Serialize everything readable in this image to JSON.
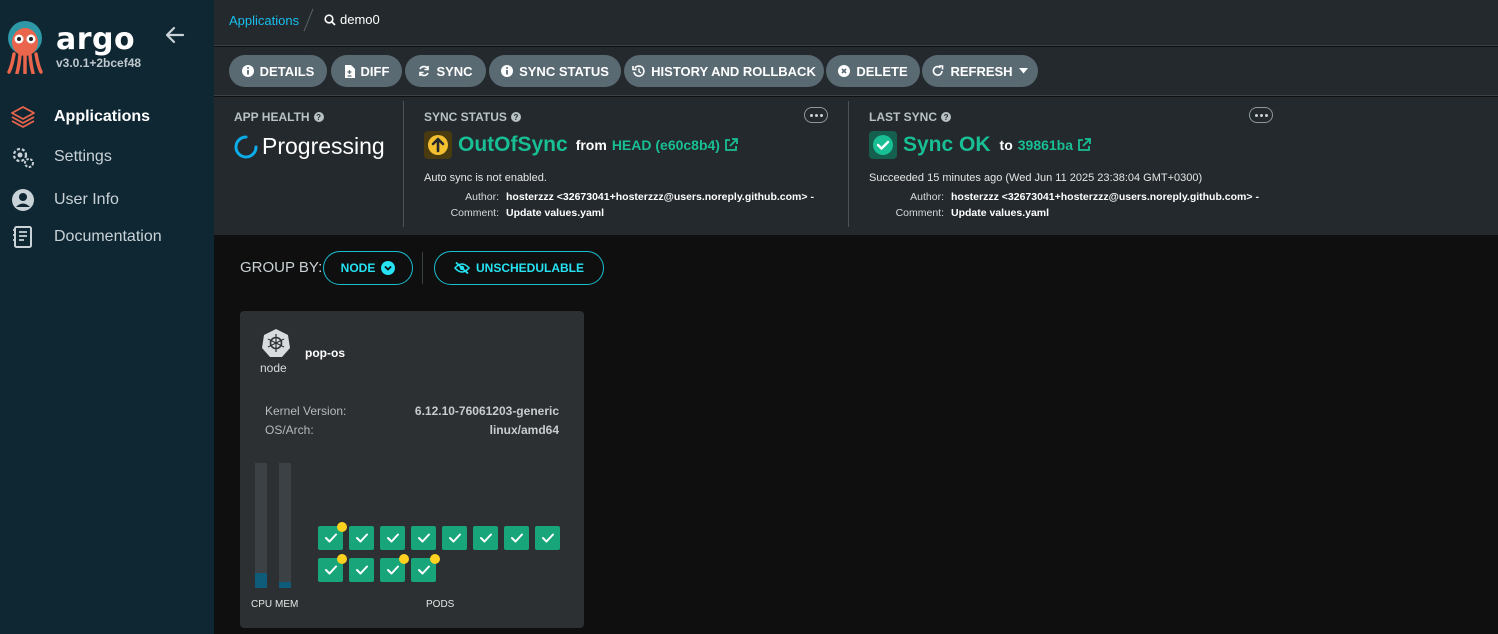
{
  "sidebar": {
    "brand": "argo",
    "version": "v3.0.1+2bcef48",
    "items": [
      {
        "label": "Applications",
        "icon": "layers-icon",
        "active": true
      },
      {
        "label": "Settings",
        "icon": "gears-icon",
        "active": false
      },
      {
        "label": "User Info",
        "icon": "user-circle-icon",
        "active": false
      },
      {
        "label": "Documentation",
        "icon": "book-icon",
        "active": false
      }
    ]
  },
  "breadcrumb": {
    "root": "Applications",
    "current": "demo0"
  },
  "toolbar": {
    "details": "DETAILS",
    "diff": "DIFF",
    "sync": "SYNC",
    "sync_status": "SYNC STATUS",
    "history": "HISTORY AND ROLLBACK",
    "delete": "DELETE",
    "refresh": "REFRESH"
  },
  "status": {
    "app_health": {
      "heading": "APP HEALTH",
      "value": "Progressing"
    },
    "sync_status": {
      "heading": "SYNC STATUS",
      "value": "OutOfSync",
      "from_label": "from",
      "revision": "HEAD (e60c8b4)",
      "note": "Auto sync is not enabled.",
      "author_label": "Author:",
      "author": "hosterzzz <32673041+hosterzzz@users.noreply.github.com> -",
      "comment_label": "Comment:",
      "comment": "Update values.yaml"
    },
    "last_sync": {
      "heading": "LAST SYNC",
      "value": "Sync OK",
      "to_label": "to",
      "revision": "39861ba",
      "note": "Succeeded 15 minutes ago (Wed Jun 11 2025 23:38:04 GMT+0300)",
      "author_label": "Author:",
      "author": "hosterzzz <32673041+hosterzzz@users.noreply.github.com> -",
      "comment_label": "Comment:",
      "comment": "Update values.yaml"
    }
  },
  "group_by": {
    "label": "GROUP BY:",
    "selected": "NODE",
    "unschedulable": "UNSCHEDULABLE"
  },
  "node": {
    "type": "node",
    "name": "pop-os",
    "props": [
      {
        "key": "Kernel Version:",
        "value": "6.12.10-76061203-generic"
      },
      {
        "key": "OS/Arch:",
        "value": "linux/amd64"
      }
    ],
    "cpu_label": "CPU",
    "mem_label": "MEM",
    "pods_label": "PODS",
    "cpu_usage": 0.12,
    "mem_usage": 0.05,
    "pods_total": 12,
    "pods_with_warning": [
      0,
      8,
      10,
      11
    ]
  },
  "colors": {
    "accent": "#18bff0",
    "health_progressing": "#0dadea",
    "out_of_sync": "#f4c030",
    "synced": "#18be94",
    "pod_healthy": "#18a57a",
    "pod_warning": "#ffd21f"
  }
}
